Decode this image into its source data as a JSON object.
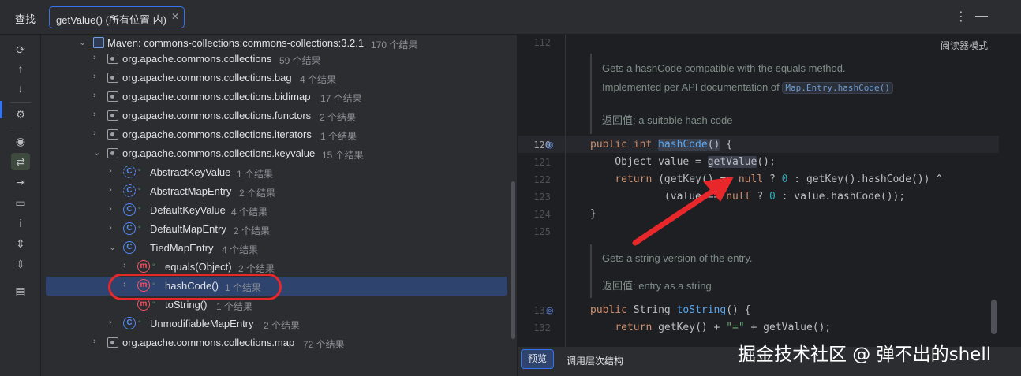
{
  "header": {
    "title": "查找",
    "tab_label": "getValue() (所有位置 内)",
    "tab_close": "✕",
    "menu_icon": "⋮"
  },
  "toolbar": {
    "icons": [
      "refresh-icon",
      "arrow-up-icon",
      "arrow-down-icon",
      "settings-icon",
      "eye-icon",
      "merge-icon",
      "export-icon",
      "folder-icon",
      "info-icon",
      "expand-icon",
      "collapse-icon",
      "preview-icon"
    ]
  },
  "tree": {
    "rows": [
      {
        "label": "Maven: commons-collections:commons-collections:3.2.1",
        "count": "170 个结果"
      },
      {
        "label": "org.apache.commons.collections",
        "count": "59 个结果"
      },
      {
        "label": "org.apache.commons.collections.bag",
        "count": "4 个结果"
      },
      {
        "label": "org.apache.commons.collections.bidimap",
        "count": "17 个结果"
      },
      {
        "label": "org.apache.commons.collections.functors",
        "count": "2 个结果"
      },
      {
        "label": "org.apache.commons.collections.iterators",
        "count": "1 个结果"
      },
      {
        "label": "org.apache.commons.collections.keyvalue",
        "count": "15 个结果"
      },
      {
        "label": "AbstractKeyValue",
        "count": "1 个结果"
      },
      {
        "label": "AbstractMapEntry",
        "count": "2 个结果"
      },
      {
        "label": "DefaultKeyValue",
        "count": "4 个结果"
      },
      {
        "label": "DefaultMapEntry",
        "count": "2 个结果"
      },
      {
        "label": "TiedMapEntry",
        "count": "4 个结果"
      },
      {
        "label": "equals(Object)",
        "count": "2 个结果"
      },
      {
        "label": "hashCode()",
        "count": "1 个结果"
      },
      {
        "label": "toString()",
        "count": "1 个结果"
      },
      {
        "label": "UnmodifiableMapEntry",
        "count": "2 个结果"
      },
      {
        "label": "org.apache.commons.collections.map",
        "count": "72 个结果"
      }
    ]
  },
  "editor": {
    "reader_mode": "阅读器模式",
    "line_numbers": [
      "112",
      "120",
      "121",
      "122",
      "123",
      "124",
      "125",
      "131",
      "132"
    ],
    "doc1": {
      "line1": "Gets a hashCode compatible with the equals method.",
      "line2_prefix": "Implemented per API documentation of ",
      "line2_code": "Map.Entry.hashCode()",
      "returns": "返回值: a suitable hash code"
    },
    "doc2": {
      "line1": "Gets a string version of the entry.",
      "returns": "返回值: entry as a string"
    }
  },
  "bottom": {
    "preview_tab": "预览",
    "hierarchy_tab": "调用层次结构"
  },
  "watermark": "掘金技术社区 @ 弹不出的shell",
  "colors": {
    "accent": "#3574f0",
    "selection": "#2e436e",
    "annotation_red": "#e8272b"
  }
}
